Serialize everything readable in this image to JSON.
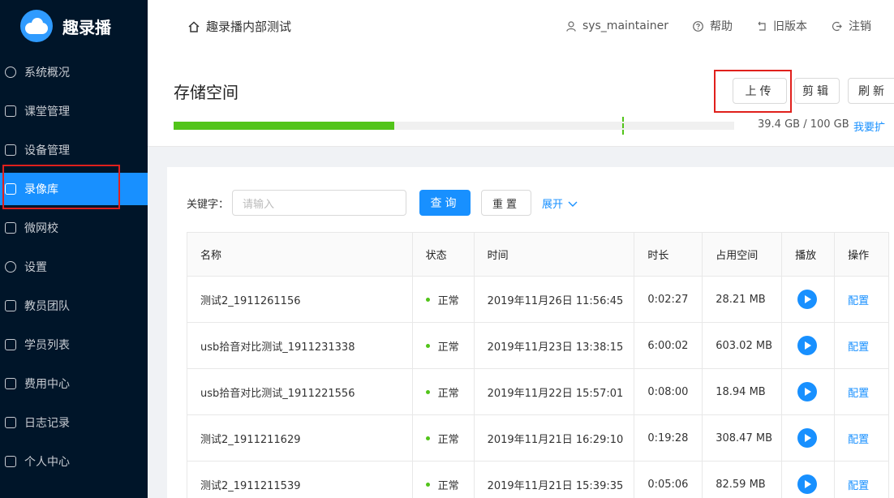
{
  "app": {
    "name": "趣录播"
  },
  "sidebar": {
    "items": [
      {
        "label": "系统概况",
        "icon": "dashboard-icon"
      },
      {
        "label": "课堂管理",
        "icon": "book-icon"
      },
      {
        "label": "设备管理",
        "icon": "camera-icon"
      },
      {
        "label": "录像库",
        "icon": "video-library-icon",
        "active": true
      },
      {
        "label": "微网校",
        "icon": "school-icon"
      },
      {
        "label": "设置",
        "icon": "gear-icon"
      },
      {
        "label": "教员团队",
        "icon": "team-icon"
      },
      {
        "label": "学员列表",
        "icon": "list-icon"
      },
      {
        "label": "费用中心",
        "icon": "billing-icon"
      },
      {
        "label": "日志记录",
        "icon": "log-icon"
      },
      {
        "label": "个人中心",
        "icon": "user-icon"
      }
    ]
  },
  "header": {
    "breadcrumb": "趣录播内部测试",
    "user": "sys_maintainer",
    "help": "帮助",
    "old_version": "旧版本",
    "logout": "注销"
  },
  "storage": {
    "title": "存储空间",
    "used_fraction": 0.394,
    "amount": "39.4 GB / 100 GB",
    "expand_link": "我要扩",
    "upload": "上传",
    "edit": "剪辑",
    "refresh": "刷新"
  },
  "search": {
    "keyword_label": "关键字：",
    "placeholder": "请输入",
    "query": "查询",
    "reset": "重置",
    "expand": "展开"
  },
  "table": {
    "headers": [
      "名称",
      "状态",
      "时间",
      "时长",
      "占用空间",
      "播放",
      "操作"
    ],
    "rows": [
      {
        "name": "测试2_1911261156",
        "status": "正常",
        "time": "2019年11月26日 11:56:45",
        "duration": "0:02:27",
        "size": "28.21 MB",
        "action": "配置"
      },
      {
        "name": "usb拾音对比测试_1911231338",
        "status": "正常",
        "time": "2019年11月23日 13:38:15",
        "duration": "6:00:02",
        "size": "603.02 MB",
        "action": "配置"
      },
      {
        "name": "usb拾音对比测试_1911221556",
        "status": "正常",
        "time": "2019年11月22日 15:57:01",
        "duration": "0:08:00",
        "size": "18.94 MB",
        "action": "配置"
      },
      {
        "name": "测试2_1911211629",
        "status": "正常",
        "time": "2019年11月21日 16:29:10",
        "duration": "0:19:28",
        "size": "308.47 MB",
        "action": "配置"
      },
      {
        "name": "测试2_1911211539",
        "status": "正常",
        "time": "2019年11月21日 15:39:35",
        "duration": "0:05:06",
        "size": "82.59 MB",
        "action": "配置"
      }
    ]
  },
  "colors": {
    "sidebar_bg": "#001529",
    "primary": "#1890ff",
    "progress": "#52c41a",
    "highlight_box": "#e0201c"
  }
}
